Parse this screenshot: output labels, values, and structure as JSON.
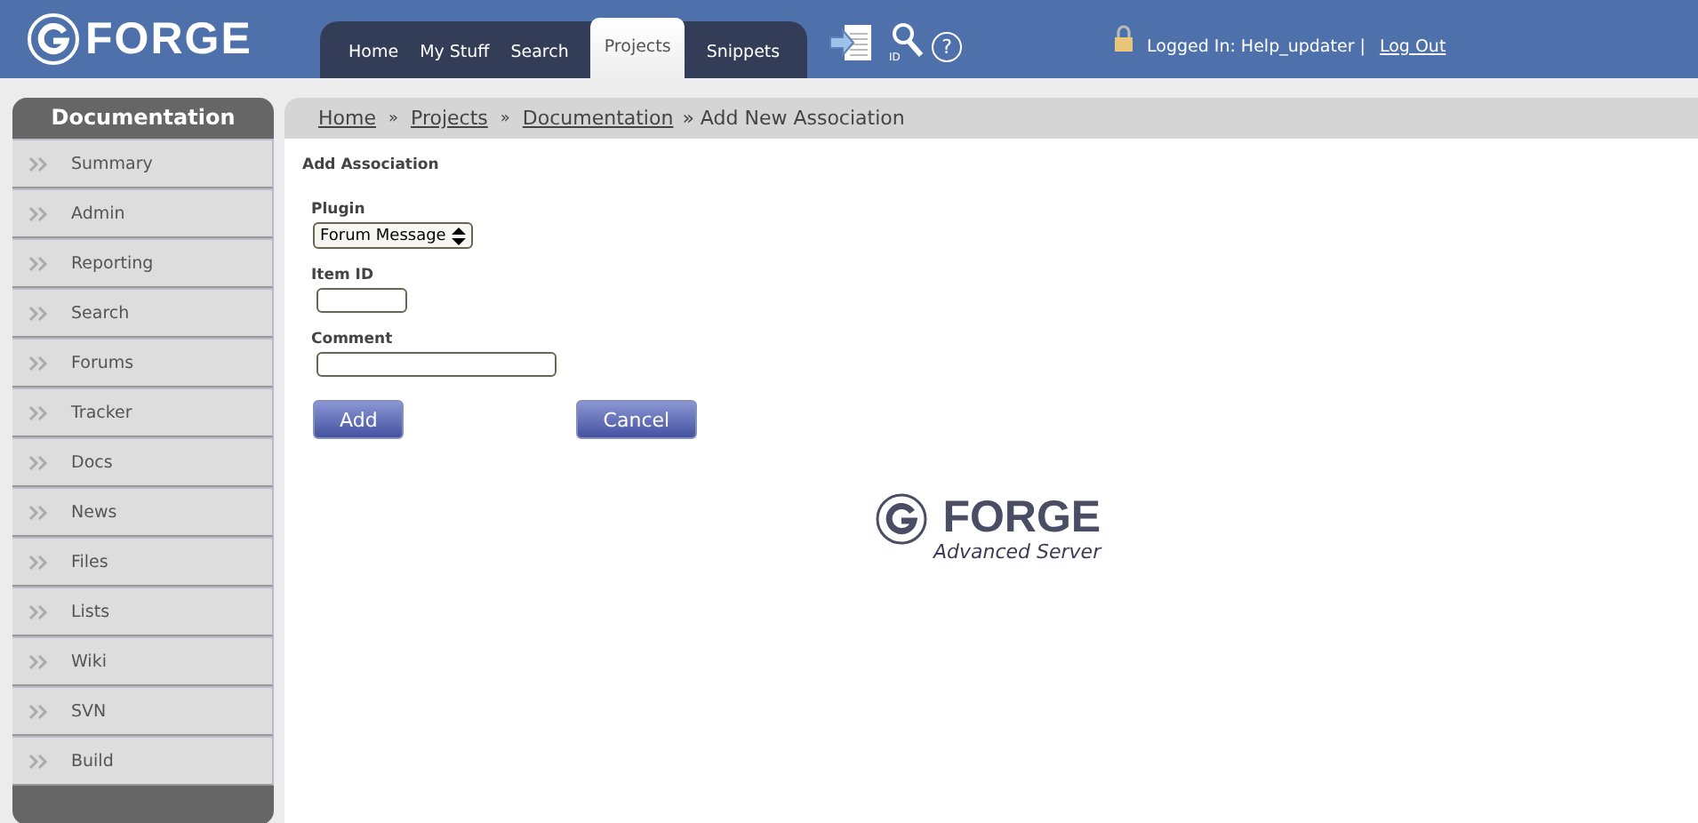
{
  "header": {
    "logo": "FORGE",
    "nav": [
      {
        "label": "Home",
        "selected": false
      },
      {
        "label": "My Stuff",
        "selected": false
      },
      {
        "label": "Search",
        "selected": false
      },
      {
        "label": "Projects",
        "selected": true
      },
      {
        "label": "Snippets",
        "selected": false
      }
    ],
    "id_label": "ID",
    "help": "?",
    "logged_in": "Logged In: Help_updater |",
    "logout": "Log Out"
  },
  "sidebar": {
    "title": "Documentation",
    "items": [
      {
        "label": "Summary"
      },
      {
        "label": "Admin"
      },
      {
        "label": "Reporting"
      },
      {
        "label": "Search"
      },
      {
        "label": "Forums"
      },
      {
        "label": "Tracker"
      },
      {
        "label": "Docs"
      },
      {
        "label": "News"
      },
      {
        "label": "Files"
      },
      {
        "label": "Lists"
      },
      {
        "label": "Wiki"
      },
      {
        "label": "SVN"
      },
      {
        "label": "Build"
      }
    ]
  },
  "breadcrumb": {
    "links": [
      "Home",
      "Projects",
      "Documentation"
    ],
    "separator": "»",
    "current": "» Add New Association"
  },
  "form": {
    "title": "Add Association",
    "plugin_label": "Plugin",
    "plugin_value": "Forum Message",
    "item_id_label": "Item ID",
    "comment_label": "Comment",
    "buttons": [
      "Add",
      "Cancel"
    ]
  },
  "footer_logo": {
    "name": "FORGE",
    "subtitle": "Advanced Server"
  }
}
